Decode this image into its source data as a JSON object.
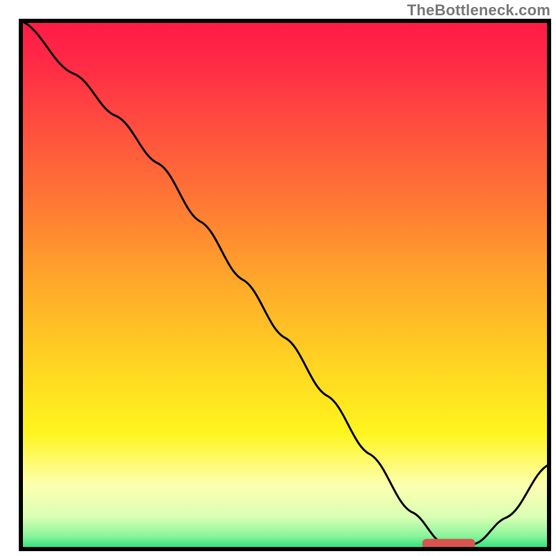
{
  "watermark": "TheBottleneck.com",
  "colors": {
    "gradient_stops": [
      {
        "offset": 0.0,
        "color": "#ff1a46"
      },
      {
        "offset": 0.08,
        "color": "#ff2a46"
      },
      {
        "offset": 0.2,
        "color": "#ff4e3f"
      },
      {
        "offset": 0.35,
        "color": "#ff7a34"
      },
      {
        "offset": 0.5,
        "color": "#ffaa2a"
      },
      {
        "offset": 0.65,
        "color": "#ffd422"
      },
      {
        "offset": 0.78,
        "color": "#fff51e"
      },
      {
        "offset": 0.88,
        "color": "#fdffb0"
      },
      {
        "offset": 0.94,
        "color": "#d8ffb4"
      },
      {
        "offset": 0.975,
        "color": "#8bf59c"
      },
      {
        "offset": 1.0,
        "color": "#22e07a"
      }
    ],
    "line": "#000000",
    "marker": "#d9534f",
    "frame": "#000000"
  },
  "chart_data": {
    "type": "line",
    "title": "",
    "xlabel": "",
    "ylabel": "",
    "xlim": [
      0,
      100
    ],
    "ylim": [
      0,
      100
    ],
    "x": [
      0,
      10,
      18,
      26,
      34,
      42,
      50,
      58,
      66,
      74,
      80,
      86,
      92,
      100
    ],
    "y": [
      100,
      90,
      82,
      73,
      62,
      51,
      40,
      29,
      18,
      7,
      1,
      1,
      6,
      16
    ],
    "marker": {
      "x_start": 76,
      "x_end": 86,
      "y": 1
    }
  }
}
